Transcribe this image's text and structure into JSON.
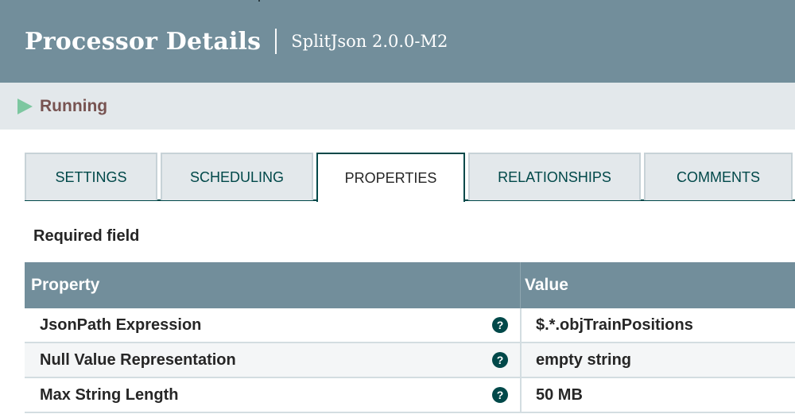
{
  "header": {
    "title": "Processor Details",
    "subtitle": "SplitJson 2.0.0-M2"
  },
  "status": {
    "icon": "play-icon",
    "text": "Running",
    "icon_color": "#7dc7a0",
    "text_color": "#775351"
  },
  "tabs": [
    {
      "label": "SETTINGS",
      "active": false
    },
    {
      "label": "SCHEDULING",
      "active": false
    },
    {
      "label": "PROPERTIES",
      "active": true
    },
    {
      "label": "RELATIONSHIPS",
      "active": false
    },
    {
      "label": "COMMENTS",
      "active": false
    }
  ],
  "required_label": "Required field",
  "table": {
    "columns": {
      "property": "Property",
      "value": "Value"
    },
    "help_icon": "question-circle-icon",
    "rows": [
      {
        "property": "JsonPath Expression",
        "value": "$.*.objTrainPositions"
      },
      {
        "property": "Null Value Representation",
        "value": "empty string"
      },
      {
        "property": "Max String Length",
        "value": "50 MB"
      }
    ]
  },
  "colors": {
    "header_bg": "#728e9b",
    "accent": "#004849",
    "tab_bg": "#e3e8eb"
  }
}
